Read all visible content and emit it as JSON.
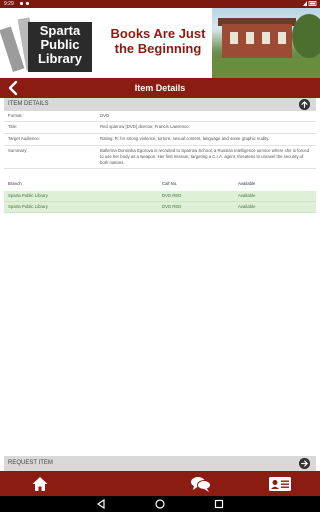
{
  "status_bar": {
    "time": "9:29"
  },
  "banner": {
    "logo_lines": [
      "Sparta",
      "Public",
      "Library"
    ],
    "tagline_lines": [
      "Books Are Just",
      "the Beginning"
    ]
  },
  "nav": {
    "title": "Item Details"
  },
  "item_details": {
    "header": "ITEM DETAILS",
    "rows": [
      {
        "label": "Format:",
        "value": "DVD"
      },
      {
        "label": "Title:",
        "value": "Red sparrow [DVD] director, Francis Lawrence."
      },
      {
        "label": "Target Audience:",
        "value": "Rating: R; for strong violence, torture, sexual content, language and some graphic nudity."
      },
      {
        "label": "Summary:",
        "value": "Ballerina Dominika Egorova is recruited to Sparrow School, a Russian intelligence service where she is forced to use her body as a weapon. Her first mission, targeting a C.I.A. agent, threatens to unravel the security of both nations."
      }
    ]
  },
  "holdings": {
    "columns": [
      "Branch",
      "Call No.",
      "Available"
    ],
    "rows": [
      {
        "branch": "Sparta Public Library",
        "call_no": "DVD RED",
        "status": "Available"
      },
      {
        "branch": "Sparta Public Library",
        "call_no": "DVD RED",
        "status": "Available"
      }
    ]
  },
  "request": {
    "header": "REQUEST ITEM"
  },
  "colors": {
    "brand": "#8b1c12",
    "available_bg": "#dff0d8"
  }
}
